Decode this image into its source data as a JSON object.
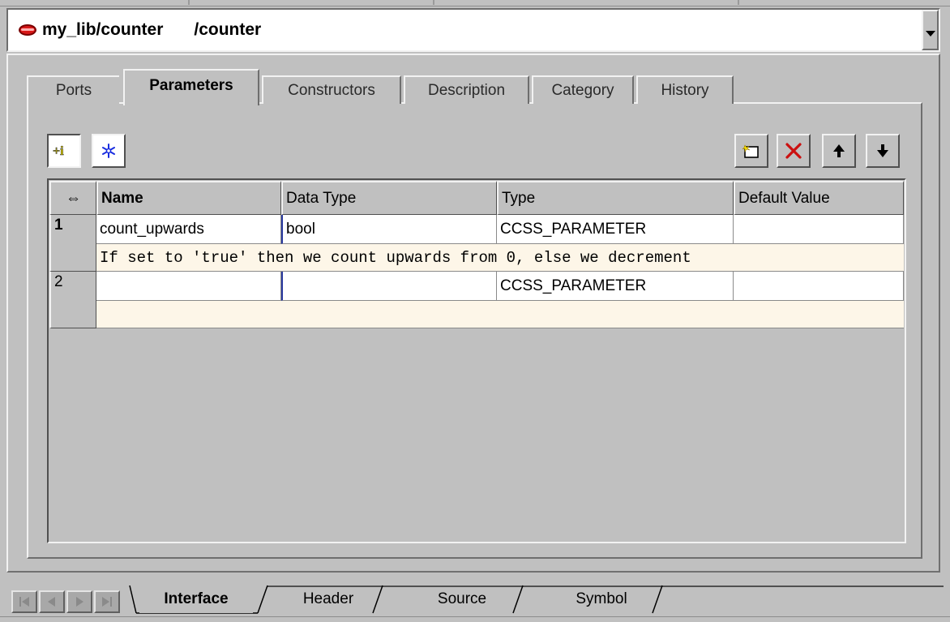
{
  "title_bar": {
    "library_path": "my_lib/counter",
    "view_path": "/counter",
    "library_icon": "library-disk-icon",
    "dropdown_icon": "chevron-down-icon"
  },
  "tabs": [
    {
      "label": "Ports",
      "active": false
    },
    {
      "label": "Parameters",
      "active": true
    },
    {
      "label": "Constructors",
      "active": false
    },
    {
      "label": "Description",
      "active": false
    },
    {
      "label": "Category",
      "active": false
    },
    {
      "label": "History",
      "active": false
    }
  ],
  "toolbar": {
    "info_button_text": "+i",
    "info_icon": "info-toggle-icon",
    "freeze_icon": "snowflake-icon",
    "new_icon": "new-row-icon",
    "delete_icon": "delete-x-icon",
    "move_up_icon": "arrow-up-icon",
    "move_down_icon": "arrow-down-icon"
  },
  "table": {
    "corner_glyph": "⇔",
    "columns": [
      "Name",
      "Data Type",
      "Type",
      "Default Value"
    ],
    "rows": [
      {
        "num": "1",
        "name": "count_upwards",
        "data_type": "bool",
        "type": "CCSS_PARAMETER",
        "default_value": "",
        "description": "If set to 'true' then we count upwards from 0, else we decrement"
      },
      {
        "num": "2",
        "name": "",
        "data_type": "",
        "type": "CCSS_PARAMETER",
        "default_value": "",
        "description": ""
      }
    ]
  },
  "bottom_tabs": [
    {
      "label": "Interface",
      "active": true
    },
    {
      "label": "Header",
      "active": false
    },
    {
      "label": "Source",
      "active": false
    },
    {
      "label": "Symbol",
      "active": false
    }
  ],
  "colors": {
    "panel_bg": "#c0c0c0",
    "description_bg": "#fdf6e8",
    "delete_red": "#cc1010",
    "freeze_blue": "#1a2ee0",
    "info_yellow": "#e8d800"
  }
}
